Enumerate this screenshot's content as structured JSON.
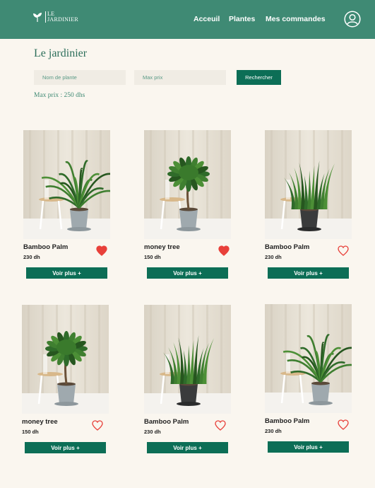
{
  "brand": {
    "line1": "LE",
    "line2": "JARDINIER"
  },
  "nav": {
    "home": "Acceuil",
    "plants": "Plantes",
    "orders": "Mes commandes"
  },
  "page": {
    "title": "Le jardinier"
  },
  "search": {
    "name_placeholder": "Nom de plante",
    "price_placeholder": "Max prix",
    "button": "Rechercher",
    "max_label": "Max prix : 250 dhs"
  },
  "products": [
    {
      "name": "Bamboo Palm",
      "price": "230 dh",
      "favorite": true,
      "plant": "palm",
      "pot": "light",
      "cta": "Voir plus +"
    },
    {
      "name": "money tree",
      "price": "150 dh",
      "favorite": true,
      "plant": "money",
      "pot": "light",
      "cta": "Voir plus +"
    },
    {
      "name": "Bamboo Palm",
      "price": "230 dh",
      "favorite": false,
      "plant": "snake",
      "pot": "dark",
      "cta": "Voir plus +"
    },
    {
      "name": "money tree",
      "price": "150 dh",
      "favorite": false,
      "plant": "money",
      "pot": "light",
      "cta": "Voir plus +"
    },
    {
      "name": "Bamboo Palm",
      "price": "230 dh",
      "favorite": false,
      "plant": "snake",
      "pot": "dark",
      "cta": "Voir plus +"
    },
    {
      "name": "Bamboo Palm",
      "price": "230 dh",
      "favorite": false,
      "plant": "palm",
      "pot": "light",
      "cta": "Voir plus +"
    }
  ],
  "colors": {
    "header": "#3f8a74",
    "button": "#0c6e56",
    "heart": "#e8403a",
    "background": "#faf6ef"
  }
}
